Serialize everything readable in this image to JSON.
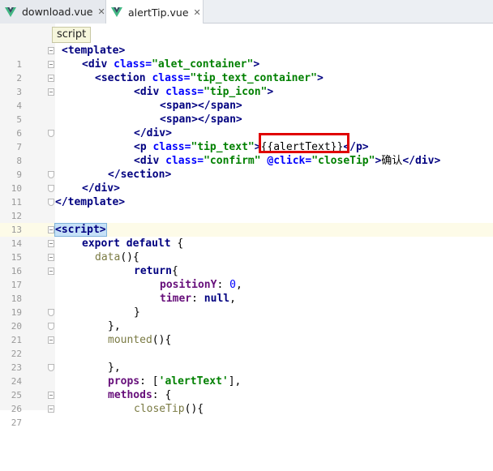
{
  "tabs": [
    {
      "label": "download.vue",
      "close": "✕",
      "active": false
    },
    {
      "label": "alertTip.vue",
      "close": "✕",
      "active": true
    }
  ],
  "breadcrumb": "script",
  "accent": "#41b883",
  "highlight_color": "#e00000",
  "lines": [
    {
      "n": "1"
    },
    {
      "n": "2"
    },
    {
      "n": "3"
    },
    {
      "n": "4"
    },
    {
      "n": "5"
    },
    {
      "n": "6"
    },
    {
      "n": "7"
    },
    {
      "n": "8"
    },
    {
      "n": "9"
    },
    {
      "n": "10"
    },
    {
      "n": "11"
    },
    {
      "n": "12"
    },
    {
      "n": "13"
    },
    {
      "n": "14"
    },
    {
      "n": "15"
    },
    {
      "n": "16"
    },
    {
      "n": "17"
    },
    {
      "n": "18"
    },
    {
      "n": "19"
    },
    {
      "n": "20"
    },
    {
      "n": "21"
    },
    {
      "n": "22"
    },
    {
      "n": "23"
    },
    {
      "n": "24"
    },
    {
      "n": "25"
    },
    {
      "n": "26"
    },
    {
      "n": "27"
    }
  ],
  "code": {
    "l1": {
      "t1": "<template>"
    },
    "l2": {
      "t1": "<div ",
      "a1": "class=",
      "s1": "\"alet_container\"",
      "t2": ">"
    },
    "l3": {
      "t1": "<section ",
      "a1": "class=",
      "s1": "\"tip_text_container\"",
      "t2": ">"
    },
    "l4": {
      "t1": "<div ",
      "a1": "class=",
      "s1": "\"tip_icon\"",
      "t2": ">"
    },
    "l5": {
      "t1": "<span></span>"
    },
    "l6": {
      "t1": "<span></span>"
    },
    "l7": {
      "t1": "</div>"
    },
    "l8": {
      "t1": "<p ",
      "a1": "class=",
      "s1": "\"tip_text\"",
      "t2": ">",
      "m": "{{alertText}}",
      "t3": "</p>"
    },
    "l9": {
      "t1": "<div ",
      "a1": "class=",
      "s1": "\"confirm\" ",
      "a2": "@click=",
      "s2": "\"closeTip\"",
      "t2": ">",
      "p": "确认",
      "t3": "</div>"
    },
    "l10": {
      "t1": "</section>"
    },
    "l11": {
      "t1": "</div>"
    },
    "l12": {
      "t1": "</template>"
    },
    "l14": {
      "t1": "<script>"
    },
    "l15": {
      "k": "export default ",
      "p": "{"
    },
    "l16": {
      "f": "data",
      "p": "(){"
    },
    "l17": {
      "k": "return",
      "p": "{"
    },
    "l18": {
      "pr": "positionY",
      "p": ": ",
      "n": "0",
      ",": ","
    },
    "l19": {
      "pr": "timer",
      "p": ": ",
      "k": "null",
      ",": ","
    },
    "l20": {
      "p": "}"
    },
    "l21": {
      "p": "},"
    },
    "l22": {
      "f": "mounted",
      "p": "(){"
    },
    "l24": {
      "p": "},"
    },
    "l25": {
      "pr": "props",
      "p": ": [",
      "s": "'alertText'",
      "p2": "],"
    },
    "l26": {
      "pr": "methods",
      "p": ": {"
    },
    "l27": {
      "f": "closeTip",
      "p": "(){"
    }
  }
}
